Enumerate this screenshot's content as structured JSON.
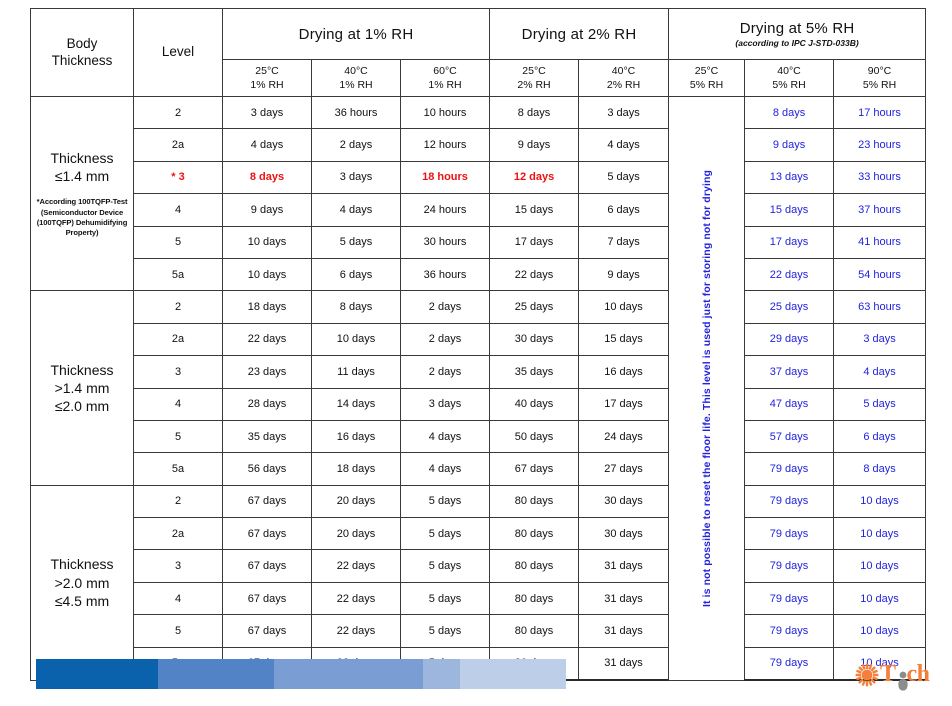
{
  "table": {
    "stub_header": "Body\nThickness",
    "stub_header_line1": "Body",
    "stub_header_line2": "Thickness",
    "level_header": "Level",
    "groups": [
      {
        "title": "Drying at 1% RH",
        "subtitle": ""
      },
      {
        "title": "Drying at 2% RH",
        "subtitle": ""
      },
      {
        "title": "Drying at 5% RH",
        "subtitle": "(according to IPC J-STD-033B)"
      }
    ],
    "conditions": [
      {
        "temp": "25°C",
        "rh": "1% RH",
        "color": "#111111"
      },
      {
        "temp": "40°C",
        "rh": "1% RH",
        "color": "#111111"
      },
      {
        "temp": "60°C",
        "rh": "1% RH",
        "color": "#111111"
      },
      {
        "temp": "25°C",
        "rh": "2% RH",
        "color": "#111111"
      },
      {
        "temp": "40°C",
        "rh": "2% RH",
        "color": "#111111"
      },
      {
        "temp": "25°C",
        "rh": "5% RH",
        "color": "#1a1ad0"
      },
      {
        "temp": "40°C",
        "rh": "5% RH",
        "color": "#1a1ad0"
      },
      {
        "temp": "90°C",
        "rh": "5% RH",
        "color": "#1a1ad0"
      }
    ],
    "storing_note": "It is not possible to reset the floor life.  This level is used just for storing not for drying",
    "sections": [
      {
        "thickness_line1": "Thickness",
        "thickness_line2": "≤1.4 mm",
        "footnote": "*According 100TQFP-Test (Semiconductor Device (100TQFP) Dehumidifying Property)",
        "rows": [
          {
            "level": "2",
            "level_red": false,
            "cells": [
              "3 days",
              "36 hours",
              "10 hours",
              "8 days",
              "3 days",
              "8 days",
              "17 hours"
            ],
            "red": [
              false,
              false,
              false,
              false,
              false
            ]
          },
          {
            "level": "2a",
            "level_red": false,
            "cells": [
              "4 days",
              "2 days",
              "12 hours",
              "9 days",
              "4 days",
              "9 days",
              "23 hours"
            ],
            "red": [
              false,
              false,
              false,
              false,
              false
            ]
          },
          {
            "level": "* 3",
            "level_red": true,
            "cells": [
              "8 days",
              "3 days",
              "18 hours",
              "12 days",
              "5 days",
              "13 days",
              "33 hours"
            ],
            "red": [
              true,
              false,
              true,
              true,
              false
            ]
          },
          {
            "level": "4",
            "level_red": false,
            "cells": [
              "9 days",
              "4 days",
              "24 hours",
              "15 days",
              "6 days",
              "15 days",
              "37 hours"
            ],
            "red": [
              false,
              false,
              false,
              false,
              false
            ]
          },
          {
            "level": "5",
            "level_red": false,
            "cells": [
              "10 days",
              "5 days",
              "30 hours",
              "17 days",
              "7 days",
              "17 days",
              "41 hours"
            ],
            "red": [
              false,
              false,
              false,
              false,
              false
            ]
          },
          {
            "level": "5a",
            "level_red": false,
            "cells": [
              "10 days",
              "6 days",
              "36 hours",
              "22 days",
              "9 days",
              "22 days",
              "54 hours"
            ],
            "red": [
              false,
              false,
              false,
              false,
              false
            ]
          }
        ]
      },
      {
        "thickness_line1": "Thickness",
        "thickness_line2": ">1.4 mm",
        "thickness_line3": "≤2.0 mm",
        "footnote": "",
        "rows": [
          {
            "level": "2",
            "level_red": false,
            "cells": [
              "18 days",
              "8 days",
              "2 days",
              "25 days",
              "10 days",
              "25 days",
              "63 hours"
            ],
            "red": [
              false,
              false,
              false,
              false,
              false
            ]
          },
          {
            "level": "2a",
            "level_red": false,
            "cells": [
              "22 days",
              "10 days",
              "2 days",
              "30 days",
              "15 days",
              "29 days",
              "3 days"
            ],
            "red": [
              false,
              false,
              false,
              false,
              false
            ]
          },
          {
            "level": "3",
            "level_red": false,
            "cells": [
              "23 days",
              "11 days",
              "2 days",
              "35 days",
              "16 days",
              "37 days",
              "4 days"
            ],
            "red": [
              false,
              false,
              false,
              false,
              false
            ]
          },
          {
            "level": "4",
            "level_red": false,
            "cells": [
              "28 days",
              "14 days",
              "3 days",
              "40 days",
              "17 days",
              "47 days",
              "5 days"
            ],
            "red": [
              false,
              false,
              false,
              false,
              false
            ]
          },
          {
            "level": "5",
            "level_red": false,
            "cells": [
              "35 days",
              "16 days",
              "4 days",
              "50 days",
              "24 days",
              "57 days",
              "6 days"
            ],
            "red": [
              false,
              false,
              false,
              false,
              false
            ]
          },
          {
            "level": "5a",
            "level_red": false,
            "cells": [
              "56 days",
              "18 days",
              "4 days",
              "67 days",
              "27 days",
              "79 days",
              "8 days"
            ],
            "red": [
              false,
              false,
              false,
              false,
              false
            ]
          }
        ]
      },
      {
        "thickness_line1": "Thickness",
        "thickness_line2": ">2.0 mm",
        "thickness_line3": "≤4.5 mm",
        "footnote": "",
        "rows": [
          {
            "level": "2",
            "level_red": false,
            "cells": [
              "67 days",
              "20 days",
              "5 days",
              "80 days",
              "30 days",
              "79 days",
              "10 days"
            ],
            "red": [
              false,
              false,
              false,
              false,
              false
            ]
          },
          {
            "level": "2a",
            "level_red": false,
            "cells": [
              "67 days",
              "20 days",
              "5 days",
              "80 days",
              "30 days",
              "79 days",
              "10 days"
            ],
            "red": [
              false,
              false,
              false,
              false,
              false
            ]
          },
          {
            "level": "3",
            "level_red": false,
            "cells": [
              "67 days",
              "22 days",
              "5 days",
              "80 days",
              "31 days",
              "79 days",
              "10 days"
            ],
            "red": [
              false,
              false,
              false,
              false,
              false
            ]
          },
          {
            "level": "4",
            "level_red": false,
            "cells": [
              "67 days",
              "22 days",
              "5 days",
              "80 days",
              "31 days",
              "79 days",
              "10 days"
            ],
            "red": [
              false,
              false,
              false,
              false,
              false
            ]
          },
          {
            "level": "5",
            "level_red": false,
            "cells": [
              "67 days",
              "22 days",
              "5 days",
              "80 days",
              "31 days",
              "79 days",
              "10 days"
            ],
            "red": [
              false,
              false,
              false,
              false,
              false
            ]
          },
          {
            "level": "5a",
            "level_red": false,
            "cells": [
              "67 days",
              "22 days",
              "5 days",
              "80 days",
              "31 days",
              "79 days",
              "10 days"
            ],
            "red": [
              false,
              false,
              false,
              false,
              false
            ]
          }
        ]
      }
    ]
  },
  "footer": {
    "bar_colors": [
      "#0a62ac",
      "#5183c6",
      "#7a9ed4",
      "#9cb6de",
      "#bdcee9"
    ],
    "logo_text": "T ch",
    "logo_text_left": "T",
    "logo_text_right": "ch",
    "logo_accent": "#f4803c"
  }
}
